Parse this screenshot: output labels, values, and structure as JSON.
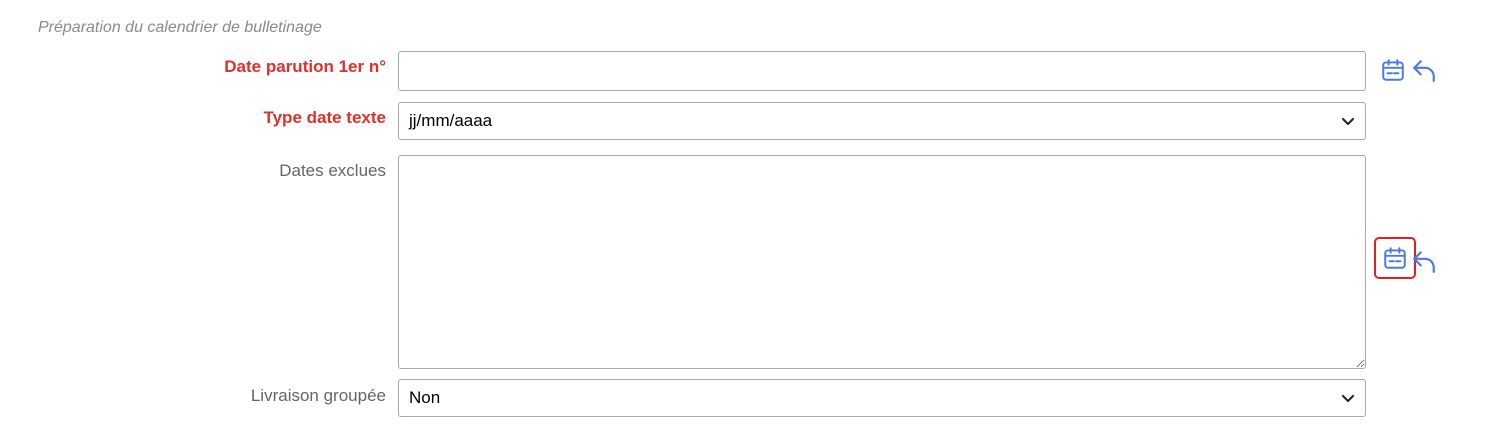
{
  "legend": "Préparation du calendrier de bulletinage",
  "fields": {
    "date_parution": {
      "label": "Date parution 1er n°",
      "value": ""
    },
    "type_date": {
      "label": "Type date texte",
      "selected": "jj/mm/aaaa"
    },
    "dates_exclues": {
      "label": "Dates exclues",
      "value": ""
    },
    "livraison": {
      "label": "Livraison groupée",
      "selected": "Non"
    }
  },
  "icons": {
    "calendar": "calendar-icon",
    "undo": "undo-icon"
  },
  "colors": {
    "required_label": "#e0302a",
    "icon_blue": "#4a78e8",
    "focus_border": "#e02020"
  }
}
